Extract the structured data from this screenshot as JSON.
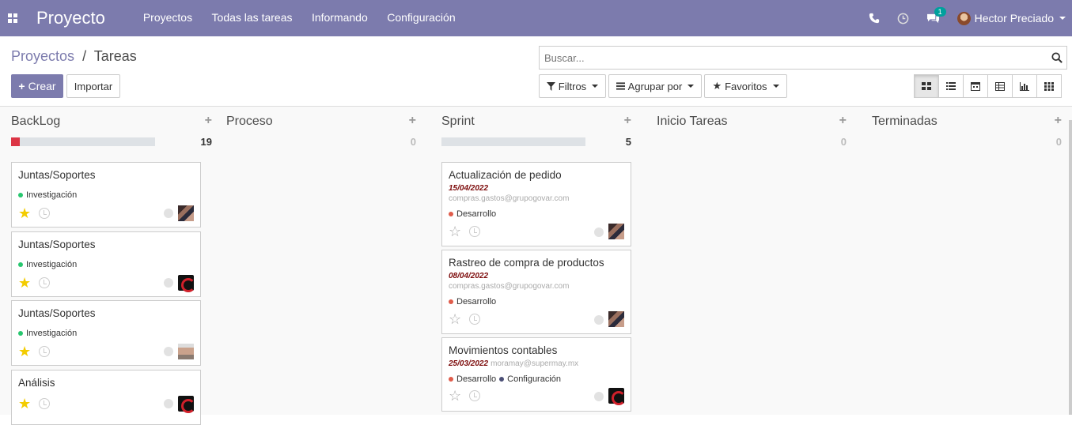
{
  "navbar": {
    "brand": "Proyecto",
    "menu": [
      "Proyectos",
      "Todas las tareas",
      "Informando",
      "Configuración"
    ],
    "chat_badge": "1",
    "user": "Hector Preciado"
  },
  "breadcrumb": {
    "parent": "Proyectos",
    "sep": "/",
    "current": "Tareas"
  },
  "search": {
    "placeholder": "Buscar..."
  },
  "buttons": {
    "create": "Crear",
    "import": "Importar",
    "filters": "Filtros",
    "group_by": "Agrupar por",
    "favorites": "Favoritos"
  },
  "columns": [
    {
      "title": "BackLog",
      "count": "19",
      "progress": 0.06
    },
    {
      "title": "Proceso",
      "count": "0"
    },
    {
      "title": "Sprint",
      "count": "5"
    },
    {
      "title": "Inicio Tareas",
      "count": "0"
    },
    {
      "title": "Terminadas",
      "count": "0"
    }
  ],
  "backlog_cards": [
    {
      "title": "Juntas/Soportes",
      "tag": "Investigación",
      "starred": true,
      "avatar": "photo"
    },
    {
      "title": "Juntas/Soportes",
      "tag": "Investigación",
      "starred": true,
      "avatar": "logo"
    },
    {
      "title": "Juntas/Soportes",
      "tag": "Investigación",
      "starred": true,
      "avatar": "face"
    },
    {
      "title": "Análisis",
      "tag": "",
      "starred": true,
      "avatar": "logo"
    }
  ],
  "sprint_cards": [
    {
      "title": "Actualización de pedido",
      "date": "15/04/2022",
      "email": "compras.gastos@grupogovar.com",
      "tags": [
        "Desarrollo"
      ],
      "starred": false,
      "avatar": "photo"
    },
    {
      "title": "Rastreo de compra de productos",
      "date": "08/04/2022",
      "email": "compras.gastos@grupogovar.com",
      "tags": [
        "Desarrollo"
      ],
      "starred": false,
      "avatar": "photo"
    },
    {
      "title": "Movimientos contables",
      "date": "25/03/2022",
      "email": "moramay@supermay.mx",
      "tags": [
        "Desarrollo",
        "Configuración"
      ],
      "starred": false,
      "avatar": "logo"
    }
  ],
  "colors": {
    "navbar": "#7c7bad",
    "tag_investigacion": "#28c76f",
    "tag_desarrollo": "#e05c4b",
    "tag_configuracion": "#4b4f76",
    "star_on": "#f3cc00"
  }
}
